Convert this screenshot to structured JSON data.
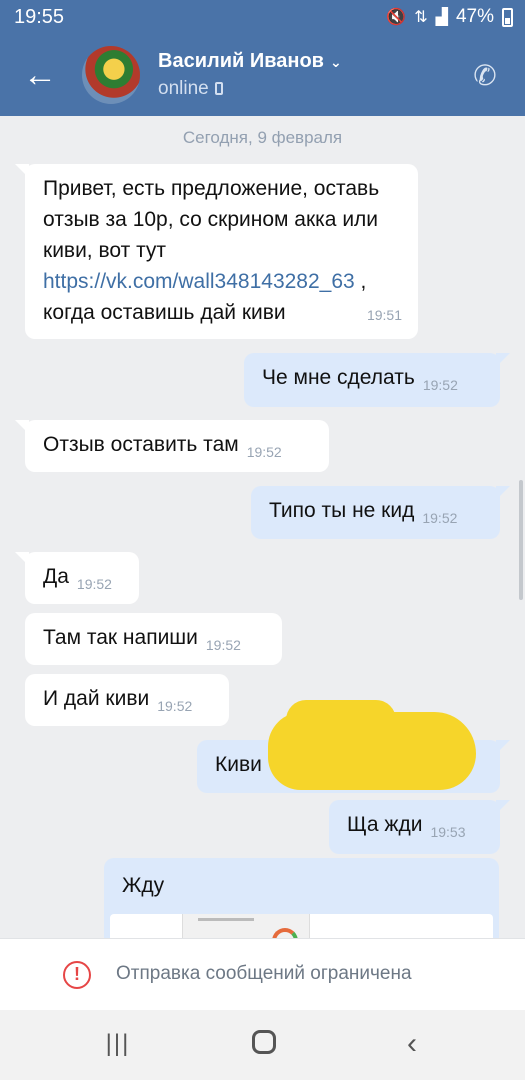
{
  "status_bar": {
    "time": "19:55",
    "battery": "47%",
    "icons": [
      "mute-icon",
      "data-arrows-icon",
      "signal-icon",
      "battery-icon"
    ]
  },
  "header": {
    "name": "Василий Иванов",
    "status": "online",
    "icons": [
      "back-arrow-icon",
      "chevron-down-icon",
      "phone-icon",
      "call-icon"
    ]
  },
  "chat": {
    "date_separator": "Сегодня, 9 февраля",
    "messages": [
      {
        "direction": "in",
        "text_before_link": "Привет, есть предложение, оставь отзыв за 10р, со скрином акка или киви, вот тут ",
        "link": "https://vk.com/wall348143282_63",
        "text_after_link": " , когда оставишь дай киви",
        "time": "19:51"
      },
      {
        "direction": "out",
        "text": "Че мне сделать",
        "time": "19:52"
      },
      {
        "direction": "in",
        "text": "Отзыв оставить там",
        "time": "19:52"
      },
      {
        "direction": "out",
        "text": "Типо ты не кид",
        "time": "19:52"
      },
      {
        "direction": "in",
        "text": "Да",
        "time": "19:52"
      },
      {
        "direction": "in",
        "text": "Там так напиши",
        "time": "19:52"
      },
      {
        "direction": "in",
        "text": "И дай киви",
        "time": "19:52"
      },
      {
        "direction": "out",
        "text": "Киви",
        "time": "",
        "redacted": true
      },
      {
        "direction": "out",
        "text": "Ща жди",
        "time": "19:53"
      },
      {
        "direction": "out",
        "text": "Жду",
        "time": "",
        "has_image": true
      }
    ]
  },
  "composer": {
    "restriction_message": "Отправка сообщений ограничена",
    "icon": "warning-icon"
  },
  "nav_bar": {
    "buttons": [
      "recent-apps-icon",
      "home-icon",
      "back-icon"
    ]
  },
  "colors": {
    "header": "#4a73a8",
    "incoming_bubble": "#ffffff",
    "outgoing_bubble": "#dce9fb",
    "background": "#edeef0",
    "redaction": "#f6d52a",
    "warning": "#e64646"
  }
}
